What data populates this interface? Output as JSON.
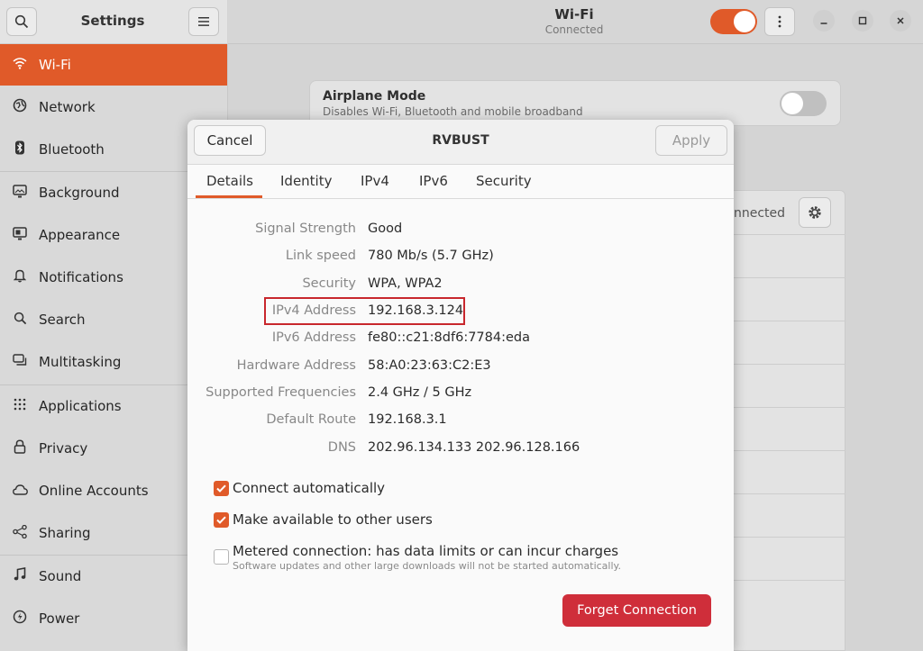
{
  "sidebar": {
    "title": "Settings",
    "items": [
      {
        "label": "Wi-Fi",
        "icon": "wifi-icon"
      },
      {
        "label": "Network",
        "icon": "network-icon"
      },
      {
        "label": "Bluetooth",
        "icon": "bluetooth-icon"
      },
      {
        "label": "Background",
        "icon": "background-icon"
      },
      {
        "label": "Appearance",
        "icon": "appearance-icon"
      },
      {
        "label": "Notifications",
        "icon": "bell-icon"
      },
      {
        "label": "Search",
        "icon": "search-icon"
      },
      {
        "label": "Multitasking",
        "icon": "multitasking-icon"
      },
      {
        "label": "Applications",
        "icon": "grid-icon"
      },
      {
        "label": "Privacy",
        "icon": "lock-icon"
      },
      {
        "label": "Online Accounts",
        "icon": "cloud-icon"
      },
      {
        "label": "Sharing",
        "icon": "share-icon"
      },
      {
        "label": "Sound",
        "icon": "music-note-icon"
      },
      {
        "label": "Power",
        "icon": "power-icon"
      }
    ]
  },
  "header": {
    "title": "Wi-Fi",
    "subtitle": "Connected"
  },
  "background": {
    "airplane_title": "Airplane Mode",
    "airplane_desc": "Disables Wi-Fi, Bluetooth and mobile broadband",
    "connected_fragment": "nnected"
  },
  "dialog": {
    "title": "RVBUST",
    "cancel_label": "Cancel",
    "apply_label": "Apply",
    "tabs": [
      "Details",
      "Identity",
      "IPv4",
      "IPv6",
      "Security"
    ],
    "details": [
      {
        "label": "Signal Strength",
        "value": "Good"
      },
      {
        "label": "Link speed",
        "value": "780 Mb/s (5.7 GHz)"
      },
      {
        "label": "Security",
        "value": "WPA, WPA2"
      },
      {
        "label": "IPv4 Address",
        "value": "192.168.3.124"
      },
      {
        "label": "IPv6 Address",
        "value": "fe80::c21:8df6:7784:eda"
      },
      {
        "label": "Hardware Address",
        "value": "58:A0:23:63:C2:E3"
      },
      {
        "label": "Supported Frequencies",
        "value": "2.4 GHz / 5 GHz"
      },
      {
        "label": "Default Route",
        "value": "192.168.3.1"
      },
      {
        "label": "DNS",
        "value": "202.96.134.133 202.96.128.166"
      }
    ],
    "checks": {
      "auto": "Connect automatically",
      "share": "Make available to other users",
      "metered": "Metered connection: has data limits or can incur charges",
      "metered_sub": "Software updates and other large downloads will not be started automatically."
    },
    "forget_label": "Forget Connection"
  },
  "colors": {
    "accent": "#e05a29",
    "destructive": "#cf2e3a",
    "highlight_box": "#c8272d"
  }
}
